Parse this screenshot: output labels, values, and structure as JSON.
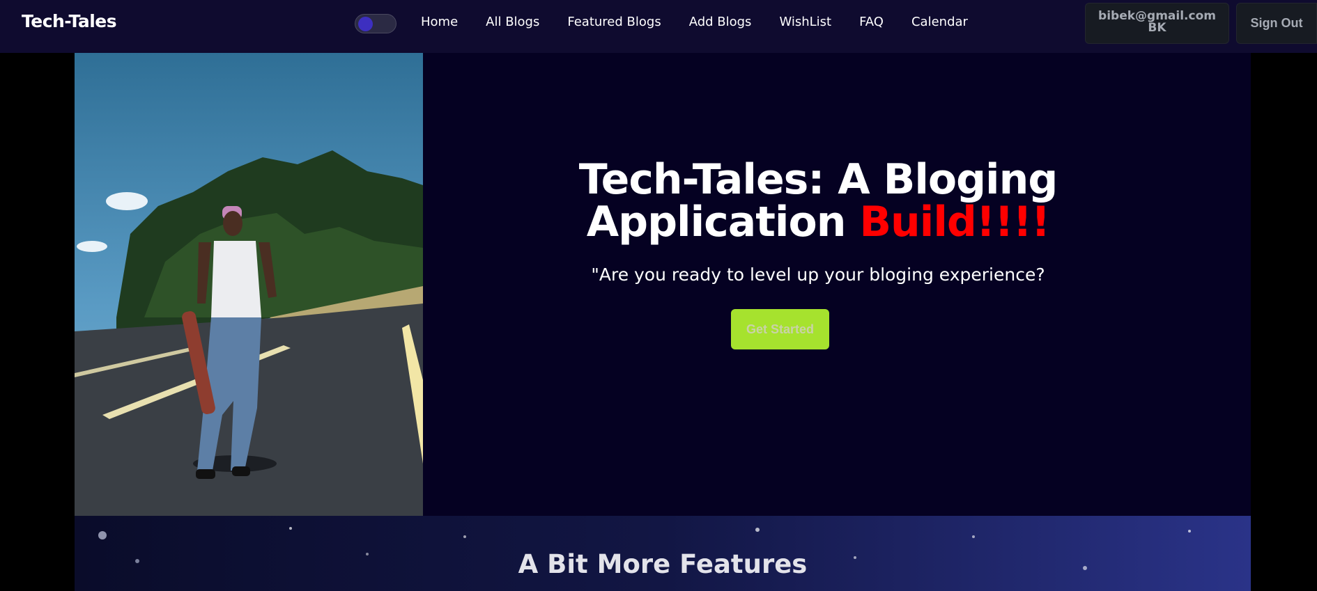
{
  "nav": {
    "brand": "Tech-Tales",
    "links": [
      "Home",
      "All Blogs",
      "Featured Blogs",
      "Add Blogs",
      "WishList",
      "FAQ",
      "Calendar"
    ],
    "user_email": "bibek@gmail.com",
    "user_initials": "BK",
    "signout_label": "Sign Out"
  },
  "hero": {
    "title_line1": "Tech-Tales: A Bloging",
    "title_line2_prefix": "Application",
    "title_line2_accent": "Build!!!!",
    "subtitle": "\"Are you ready to level up your bloging experience?",
    "cta_label": "Get Started"
  },
  "features": {
    "heading": "A Bit More Features"
  },
  "colors": {
    "nav_bg": "#0f0b2f",
    "hero_bg": "#050122",
    "accent_red": "#ff0000",
    "cta_bg": "#a6e22e",
    "toggle_knob": "#3d2fc0"
  },
  "icons": {
    "theme_toggle": "theme-toggle-switch"
  }
}
